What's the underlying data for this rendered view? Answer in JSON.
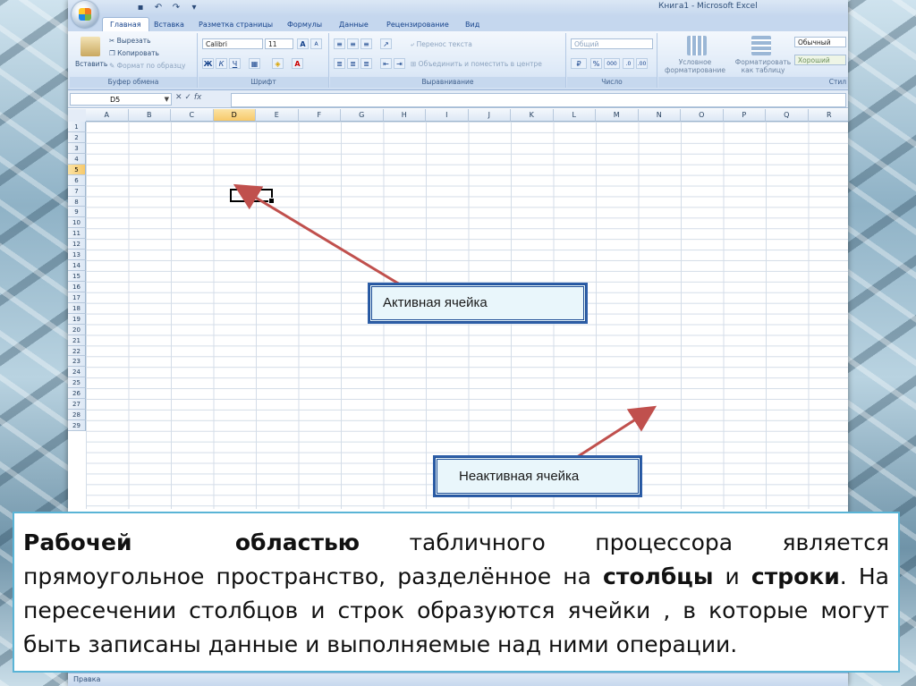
{
  "window": {
    "title": "Книга1 - Microsoft Excel"
  },
  "quick_access": {
    "save_icon": "save-icon",
    "undo_icon": "undo-icon",
    "redo_icon": "redo-icon"
  },
  "tabs": [
    "Главная",
    "Вставка",
    "Разметка страницы",
    "Формулы",
    "Данные",
    "Рецензирование",
    "Вид"
  ],
  "ribbon": {
    "clipboard": {
      "paste": "Вставить",
      "cut": "Вырезать",
      "copy": "Копировать",
      "format_painter": "Формат по образцу",
      "label": "Буфер обмена"
    },
    "font": {
      "name": "Calibri",
      "size": "11",
      "bold": "Ж",
      "italic": "К",
      "underline": "Ч",
      "grow": "A",
      "shrink": "A",
      "label": "Шрифт"
    },
    "alignment": {
      "wrap_text": "Перенос текста",
      "merge_center": "Объединить и поместить в центре",
      "label": "Выравнивание"
    },
    "number": {
      "format": "Общий",
      "percent": "%",
      "thousands": "000",
      "label": "Число"
    },
    "styles": {
      "conditional": "Условное форматирование",
      "as_table": "Форматировать как таблицу",
      "normal": "Обычный",
      "good": "Хороший",
      "label": "Стил"
    }
  },
  "formula_bar": {
    "name_box": "D5",
    "fx": "fx",
    "value": ""
  },
  "grid": {
    "columns": [
      "A",
      "B",
      "C",
      "D",
      "E",
      "F",
      "G",
      "H",
      "I",
      "J",
      "K",
      "L",
      "M",
      "N",
      "O",
      "P",
      "Q",
      "R"
    ],
    "rows": [
      "1",
      "2",
      "3",
      "4",
      "5",
      "6",
      "7",
      "8",
      "9",
      "10",
      "11",
      "12",
      "13",
      "14",
      "15",
      "16",
      "17",
      "18",
      "19",
      "20",
      "21",
      "22",
      "23",
      "24",
      "25",
      "26",
      "27",
      "28",
      "29"
    ],
    "active_column": "D",
    "active_row": "5"
  },
  "callouts": {
    "active": "Активная ячейка",
    "inactive": "Неактивная ячейка"
  },
  "caption": {
    "w1": "Рабочей",
    "w2": "областью",
    "t1": " табличного процессора является прямоугольное пространство, разделённое на ",
    "w3": "столбцы",
    "t2": " и ",
    "w4": "строки",
    "t3": ". На пересечении столбцов и строк образуются ячейки , в которые могут быть записаны данные и выполняемые над ними операции."
  },
  "status": {
    "text": "Правка"
  },
  "colors": {
    "ribbon": "#dde9f7",
    "arrow": "#c0504d",
    "callout_border": "#1f4e96",
    "caption_border": "#5ab4d6"
  }
}
